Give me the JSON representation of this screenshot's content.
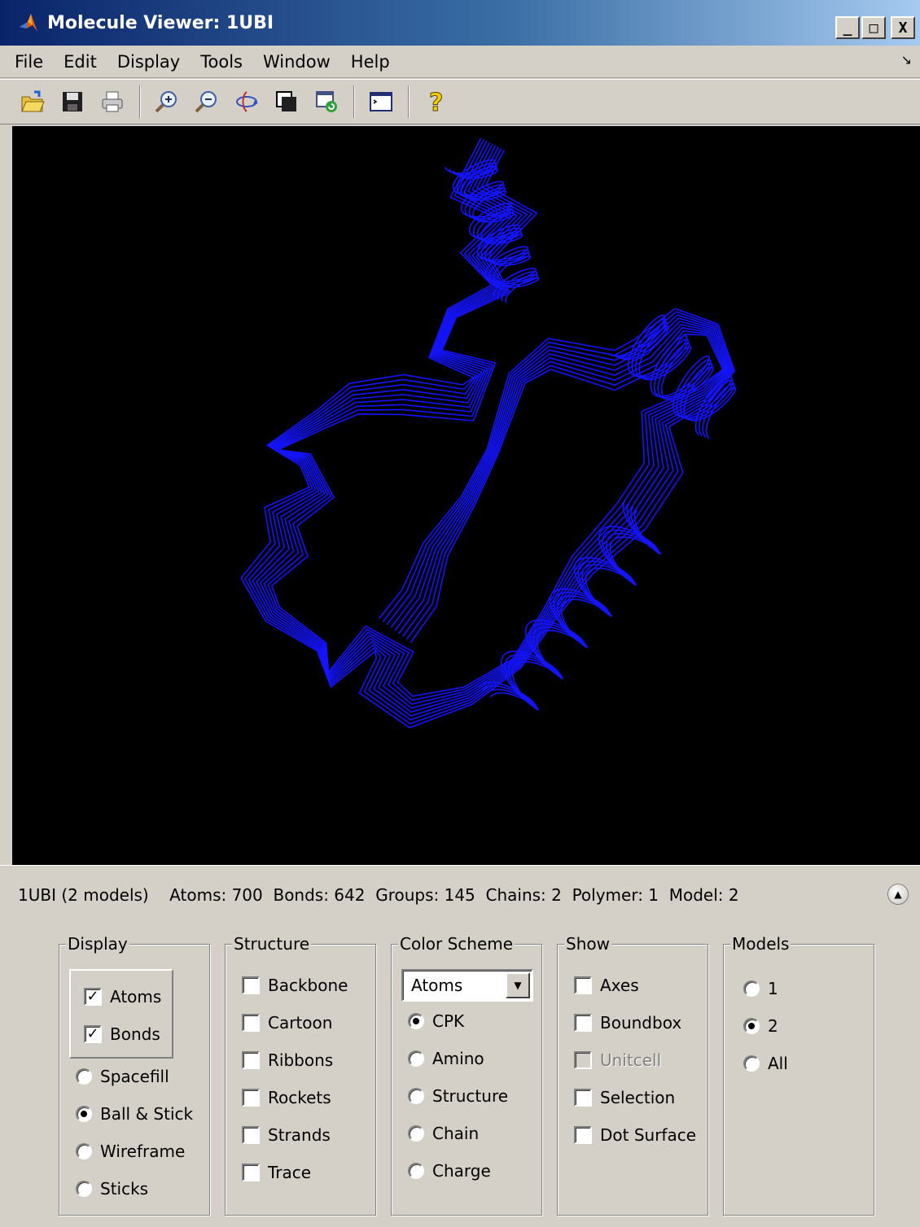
{
  "window": {
    "title": "Molecule Viewer: 1UBI",
    "controls": {
      "minimize": "_",
      "maximize": "□",
      "close": "X"
    }
  },
  "menu": [
    "File",
    "Edit",
    "Display",
    "Tools",
    "Window",
    "Help"
  ],
  "toolbar": [
    "open-file-icon",
    "save-icon",
    "print-icon",
    "zoom-in-icon",
    "zoom-out-icon",
    "rotate-icon",
    "data-cursor-icon",
    "reset-view-icon",
    "command-window-icon",
    "help-icon"
  ],
  "viewer": {
    "background": "#000000",
    "ribbon_color": "#1414ff"
  },
  "info": {
    "molecule": "1UBI (2 models)",
    "stats": "Atoms: 700  Bonds: 642  Groups: 145  Chains: 2  Polymer: 1  Model: 2"
  },
  "display_panel": {
    "title": "Display",
    "checkboxes": [
      {
        "label": "Atoms",
        "checked": true
      },
      {
        "label": "Bonds",
        "checked": true
      }
    ],
    "radios": [
      {
        "label": "Spacefill",
        "selected": false
      },
      {
        "label": "Ball & Stick",
        "selected": true
      },
      {
        "label": "Wireframe",
        "selected": false
      },
      {
        "label": "Sticks",
        "selected": false
      }
    ]
  },
  "structure_panel": {
    "title": "Structure",
    "checkboxes": [
      {
        "label": "Backbone",
        "checked": false
      },
      {
        "label": "Cartoon",
        "checked": false
      },
      {
        "label": "Ribbons",
        "checked": false
      },
      {
        "label": "Rockets",
        "checked": false
      },
      {
        "label": "Strands",
        "checked": false
      },
      {
        "label": "Trace",
        "checked": false
      }
    ]
  },
  "color_panel": {
    "title": "Color Scheme",
    "select_value": "Atoms",
    "radios": [
      {
        "label": "CPK",
        "selected": true
      },
      {
        "label": "Amino",
        "selected": false
      },
      {
        "label": "Structure",
        "selected": false
      },
      {
        "label": "Chain",
        "selected": false
      },
      {
        "label": "Charge",
        "selected": false
      }
    ]
  },
  "show_panel": {
    "title": "Show",
    "checkboxes": [
      {
        "label": "Axes",
        "checked": false,
        "enabled": true
      },
      {
        "label": "Boundbox",
        "checked": false,
        "enabled": true
      },
      {
        "label": "Unitcell",
        "checked": false,
        "enabled": false
      },
      {
        "label": "Selection",
        "checked": false,
        "enabled": true
      },
      {
        "label": "Dot Surface",
        "checked": false,
        "enabled": true
      }
    ]
  },
  "models_panel": {
    "title": "Models",
    "radios": [
      {
        "label": "1",
        "selected": false
      },
      {
        "label": "2",
        "selected": true
      },
      {
        "label": "All",
        "selected": false
      }
    ]
  }
}
